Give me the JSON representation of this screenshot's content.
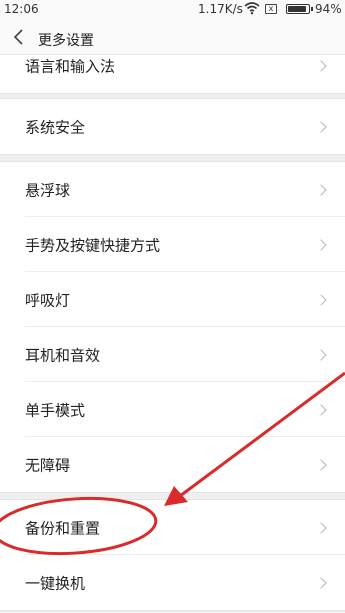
{
  "status_bar": {
    "time": "12:06",
    "speed": "1.17K/s",
    "sim_icon_text": "x",
    "battery_percent": "94%",
    "battery_level": 0.94,
    "icons": [
      "wifi-icon",
      "no-sim-icon",
      "battery-icon"
    ]
  },
  "header": {
    "back_icon": "chevron-left-icon",
    "title": "更多设置"
  },
  "groups": [
    {
      "items": [
        {
          "label": "语言和输入法"
        }
      ]
    },
    {
      "items": [
        {
          "label": "系统安全"
        }
      ]
    },
    {
      "items": [
        {
          "label": "悬浮球"
        },
        {
          "label": "手势及按键快捷方式"
        },
        {
          "label": "呼吸灯"
        },
        {
          "label": "耳机和音效"
        },
        {
          "label": "单手模式"
        },
        {
          "label": "无障碍"
        }
      ]
    },
    {
      "items": [
        {
          "label": "备份和重置"
        },
        {
          "label": "一键换机"
        }
      ]
    }
  ],
  "annotation": {
    "color": "#d92b2b",
    "highlighted_item": "备份和重置"
  }
}
